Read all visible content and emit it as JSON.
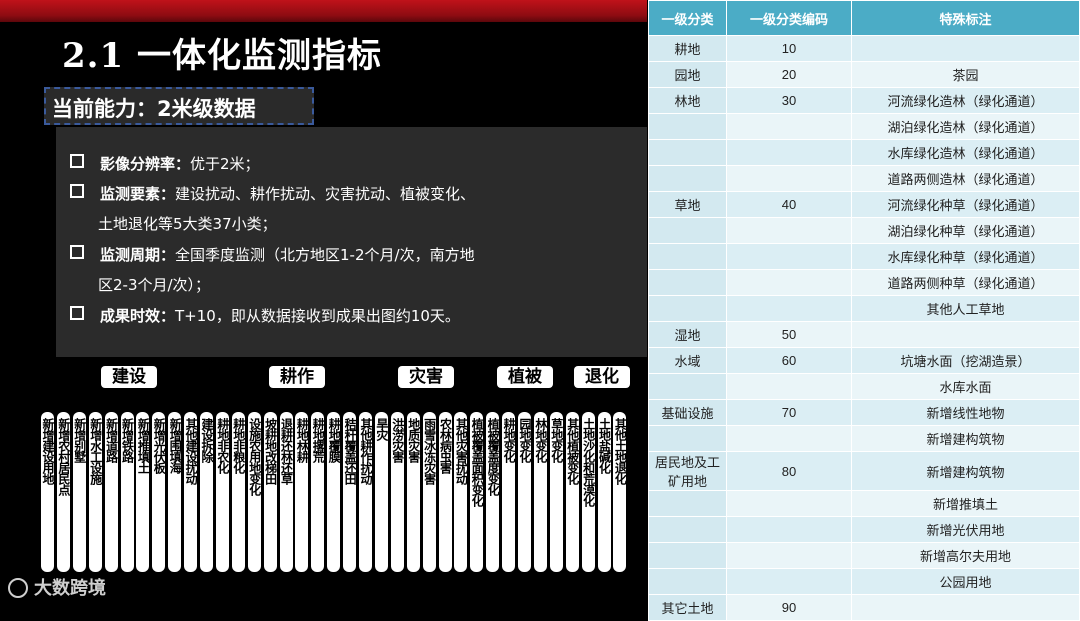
{
  "title": "2.1 一体化监测指标",
  "capability": "当前能力：2米级数据",
  "bullets": {
    "b1_label": "影像分辨率：",
    "b1_text": "优于2米；",
    "b2_label": "监测要素：",
    "b2_text": "建设扰动、耕作扰动、灾害扰动、植被变化、",
    "b2_cont": "土地退化等5大类37小类；",
    "b3_label": "监测周期：",
    "b3_text": "全国季度监测（北方地区1-2个月/次，南方地",
    "b3_cont": "区2-3个月/次）；",
    "b4_label": "成果时效：",
    "b4_text": "T+10，即从数据接收到成果出图约10天。"
  },
  "categories": [
    "建设",
    "耕作",
    "灾害",
    "植被",
    "退化"
  ],
  "items": [
    "新增建设用地",
    "新增农村居民点",
    "新增别墅",
    "新增水工设施",
    "新增道路",
    "新增铁路",
    "新增推填土",
    "新增光伏板",
    "新增围填海",
    "其他建设扰动",
    "建设拆除",
    "耕地非农化",
    "耕地非粮化",
    "设施农用地变化",
    "坡耕地改梯田",
    "退耕还林还草",
    "耕地林耕",
    "耕地撂荒",
    "耕地覆膜",
    "秸秆覆盖还田",
    "其他耕作扰动",
    "旱灾",
    "洪涝灾害",
    "地质灾害",
    "雨雪冰冻灾害",
    "农林病虫害",
    "其他灾害扰动",
    "植被覆盖面积变化",
    "植被覆盖度变化",
    "耕地变化",
    "园地变化",
    "林地变化",
    "草地变化",
    "其他植被变化",
    "土地沙化和荒漠化",
    "土地盐碱化",
    "其他土地退化"
  ],
  "logo": "大数跨境",
  "table": {
    "headers": [
      "一级分类",
      "一级分类编码",
      "特殊标注"
    ],
    "rows": [
      [
        "耕地",
        "10",
        ""
      ],
      [
        "园地",
        "20",
        "茶园"
      ],
      [
        "林地",
        "30",
        "河流绿化造林（绿化通道）"
      ],
      [
        "",
        "",
        "湖泊绿化造林（绿化通道）"
      ],
      [
        "",
        "",
        "水库绿化造林（绿化通道）"
      ],
      [
        "",
        "",
        "道路两侧造林（绿化通道）"
      ],
      [
        "草地",
        "40",
        "河流绿化种草（绿化通道）"
      ],
      [
        "",
        "",
        "湖泊绿化种草（绿化通道）"
      ],
      [
        "",
        "",
        "水库绿化种草（绿化通道）"
      ],
      [
        "",
        "",
        "道路两侧种草（绿化通道）"
      ],
      [
        "",
        "",
        "其他人工草地"
      ],
      [
        "湿地",
        "50",
        ""
      ],
      [
        "水域",
        "60",
        "坑塘水面（挖湖造景）"
      ],
      [
        "",
        "",
        "水库水面"
      ],
      [
        "基础设施",
        "70",
        "新增线性地物"
      ],
      [
        "",
        "",
        "新增建构筑物"
      ],
      [
        "居民地及工矿用地",
        "80",
        "新增建构筑物"
      ],
      [
        "",
        "",
        "新增推填土"
      ],
      [
        "",
        "",
        "新增光伏用地"
      ],
      [
        "",
        "",
        "新增高尔夫用地"
      ],
      [
        "",
        "",
        "公园用地"
      ],
      [
        "其它土地",
        "90",
        ""
      ]
    ]
  }
}
